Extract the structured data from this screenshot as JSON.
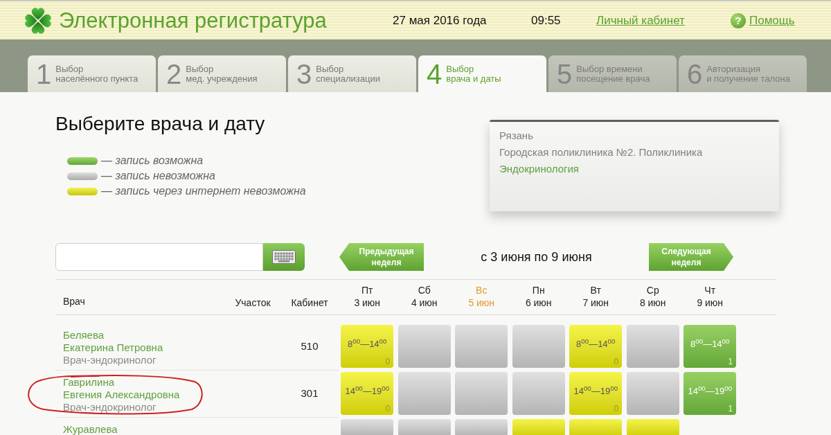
{
  "header": {
    "title": "Электронная регистратура",
    "date": "27 мая 2016 года",
    "time": "09:55",
    "account_link": "Личный кабинет",
    "help": {
      "icon": "?",
      "label": "Помощь"
    }
  },
  "steps": [
    {
      "number": "1",
      "lines": [
        "Выбор",
        "населённого пункта"
      ],
      "selected": false,
      "disabled": false
    },
    {
      "number": "2",
      "lines": [
        "Выбор",
        "мед. учреждения"
      ],
      "selected": false,
      "disabled": false
    },
    {
      "number": "3",
      "lines": [
        "Выбор",
        "специализации"
      ],
      "selected": false,
      "disabled": false
    },
    {
      "number": "4",
      "lines": [
        "Выбор",
        "врача и даты"
      ],
      "selected": true,
      "disabled": false
    },
    {
      "number": "5",
      "lines": [
        "Выбор времени",
        "посещение врача"
      ],
      "selected": false,
      "disabled": true
    },
    {
      "number": "6",
      "lines": [
        "Авторизация",
        "и получение талона"
      ],
      "selected": false,
      "disabled": true
    }
  ],
  "heading": "Выберите врача и дату",
  "legend": [
    {
      "kind": "available",
      "label": "— запись возможна"
    },
    {
      "kind": "unavailable",
      "label": "— запись невозможна"
    },
    {
      "kind": "offline",
      "label": "— запись через интернет невозможна"
    }
  ],
  "selection": {
    "city": "Рязань",
    "clinic": "Городская поликлиника №2. Поликлиника",
    "specialty": "Эндокринология"
  },
  "week": {
    "previous": "Предыдущая неделя",
    "range": "с 3 июня по 9 июня",
    "next": "Следующая неделя"
  },
  "table": {
    "columns": {
      "doctor": "Врач",
      "district": "Участок",
      "room": "Кабинет"
    },
    "days": [
      {
        "weekday": "Пт",
        "date": "3 июн",
        "highlighted": false
      },
      {
        "weekday": "Сб",
        "date": "4 июн",
        "highlighted": false
      },
      {
        "weekday": "Вс",
        "date": "5 июн",
        "highlighted": true
      },
      {
        "weekday": "Пн",
        "date": "6 июн",
        "highlighted": false
      },
      {
        "weekday": "Вт",
        "date": "7 июн",
        "highlighted": false
      },
      {
        "weekday": "Ср",
        "date": "8 июн",
        "highlighted": false
      },
      {
        "weekday": "Чт",
        "date": "9 июн",
        "highlighted": false
      }
    ],
    "rows": [
      {
        "surname": "Беляева",
        "given_names": "Екатерина Петровна",
        "position": "Врач-эндокринолог",
        "room": "510",
        "circled": false,
        "slots": [
          {
            "kind": "offline",
            "hours": "8$^{00}$—14$^{00}$",
            "count": "0"
          },
          {
            "kind": "unavailable"
          },
          {
            "kind": "unavailable"
          },
          {
            "kind": "unavailable"
          },
          {
            "kind": "offline",
            "hours": "8$^{00}$—14$^{00}$",
            "count": "0"
          },
          {
            "kind": "unavailable"
          },
          {
            "kind": "available",
            "hours": "8$^{00}$—14$^{00}$",
            "count": "1"
          }
        ]
      },
      {
        "surname": "Гаврилина",
        "given_names": "Евгения Александровна",
        "position": "Врач-эндокринолог",
        "room": "301",
        "circled": true,
        "slots": [
          {
            "kind": "offline",
            "hours": "14$^{00}$—19$^{00}$",
            "count": "0"
          },
          {
            "kind": "unavailable"
          },
          {
            "kind": "unavailable"
          },
          {
            "kind": "unavailable"
          },
          {
            "kind": "offline",
            "hours": "14$^{00}$—19$^{00}$",
            "count": "0"
          },
          {
            "kind": "unavailable"
          },
          {
            "kind": "available",
            "hours": "14$^{00}$—19$^{00}$",
            "count": "1"
          }
        ]
      },
      {
        "surname": "Журавлева",
        "circled": false,
        "slots": [
          {
            "kind": "unavailable"
          },
          {
            "kind": "unavailable"
          },
          {
            "kind": "unavailable"
          },
          {
            "kind": "offline"
          },
          {
            "kind": "offline"
          },
          {
            "kind": "offline"
          }
        ]
      }
    ]
  }
}
